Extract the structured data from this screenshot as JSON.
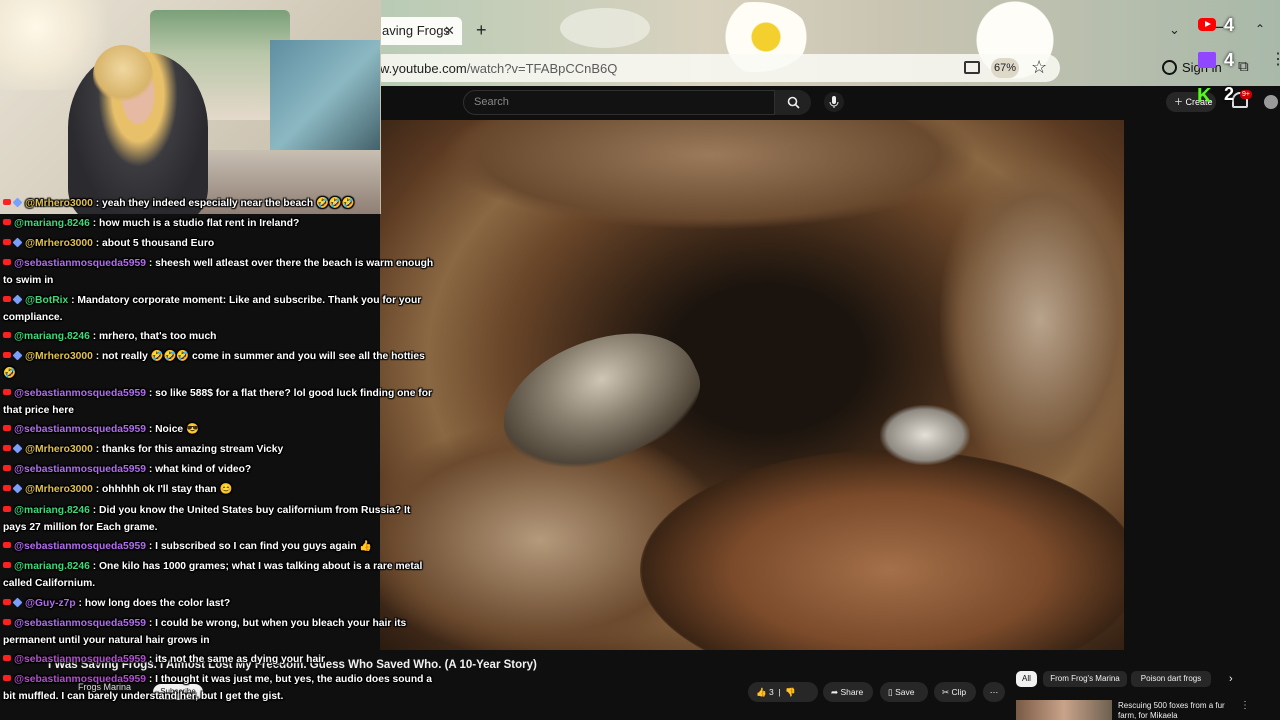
{
  "browser": {
    "tab_title": "aving Frogs",
    "tab_close": "✕",
    "new_tab": "+",
    "tab_menu": "⌄",
    "url_host": "w.youtube.com",
    "url_path": "/watch?v=TFABpCCnB6Q",
    "zoom": "67%",
    "sign_in": "Sign in"
  },
  "youtube": {
    "search_placeholder": "Search",
    "create_label": "Create",
    "notification_count": "9+",
    "video_title": "I Was Saving Frogs. I Almost Lost My Freedom. Guess Who Saved Who. (A 10-Year Story)",
    "channel_name": "Frogs Marina",
    "subscribe_label": "Subscribe",
    "like_count": "3",
    "share_label": "Share",
    "save_label": "Save",
    "clip_label": "Clip",
    "chips": [
      "All",
      "From Frog's Marina",
      "Poison dart frogs"
    ],
    "recommended_title": "Rescuing 500 foxes from a fur farm, for Mikaela"
  },
  "stream_overlay": {
    "youtube_viewers": "4",
    "twitch_viewers": "4",
    "kick_viewers": "2"
  },
  "chat": [
    {
      "user": "@Mrhero3000",
      "platform": "youtube",
      "mod": true,
      "color": "gold",
      "text": "yeah they indeed especially near the beach 🤣🤣🤣"
    },
    {
      "user": "@mariang.8246",
      "platform": "youtube",
      "mod": false,
      "color": "green",
      "text": "how much is a studio flat rent in Ireland?"
    },
    {
      "user": "@Mrhero3000",
      "platform": "youtube",
      "mod": true,
      "color": "gold",
      "text": "about 5 thousand Euro"
    },
    {
      "user": "@sebastianmosqueda5959",
      "platform": "youtube",
      "mod": false,
      "color": "purple",
      "text": "sheesh well atleast over there the beach is warm enough to swim in"
    },
    {
      "user": "@BotRix",
      "platform": "youtube",
      "mod": true,
      "color": "green",
      "text": "Mandatory corporate moment: Like and subscribe. Thank you for your compliance."
    },
    {
      "user": "@mariang.8246",
      "platform": "youtube",
      "mod": false,
      "color": "green",
      "text": "mrhero, that's too much"
    },
    {
      "user": "@Mrhero3000",
      "platform": "youtube",
      "mod": true,
      "color": "gold",
      "text": "not really 🤣🤣🤣 come in summer and you will see all the hotties 🤣"
    },
    {
      "user": "@sebastianmosqueda5959",
      "platform": "youtube",
      "mod": false,
      "color": "purple",
      "text": "so like 588$ for a flat there? lol good luck finding one for that price here"
    },
    {
      "user": "@sebastianmosqueda5959",
      "platform": "youtube",
      "mod": false,
      "color": "purple",
      "text": "Noice 😎"
    },
    {
      "user": "@Mrhero3000",
      "platform": "youtube",
      "mod": true,
      "color": "gold",
      "text": "thanks for this amazing stream Vicky"
    },
    {
      "user": "@sebastianmosqueda5959",
      "platform": "youtube",
      "mod": false,
      "color": "purple",
      "text": "what kind of video?"
    },
    {
      "user": "@Mrhero3000",
      "platform": "youtube",
      "mod": true,
      "color": "gold",
      "text": "ohhhhh ok I'll stay than 😊"
    },
    {
      "user": "@mariang.8246",
      "platform": "youtube",
      "mod": false,
      "color": "green",
      "text": "Did you know the United States buy californium from Russia? It pays 27 million for Each grame."
    },
    {
      "user": "@sebastianmosqueda5959",
      "platform": "youtube",
      "mod": false,
      "color": "purple",
      "text": "I subscribed so I can find you guys again 👍"
    },
    {
      "user": "@mariang.8246",
      "platform": "youtube",
      "mod": false,
      "color": "green",
      "text": "One kilo has 1000 grames; what I was talking about is a rare metal called Californium."
    },
    {
      "user": "@Guy-z7p",
      "platform": "youtube",
      "mod": true,
      "color": "purple",
      "text": "how long does the color last?"
    },
    {
      "user": "@sebastianmosqueda5959",
      "platform": "youtube",
      "mod": false,
      "color": "purple",
      "text": "I could be wrong, but when you bleach your hair its permanent until your natural hair grows in"
    },
    {
      "user": "@sebastianmosqueda5959",
      "platform": "youtube",
      "mod": false,
      "color": "yt",
      "text": "its not the same as dying your hair"
    },
    {
      "user": "@sebastianmosqueda5959",
      "platform": "youtube",
      "mod": false,
      "color": "yt",
      "text": "I thought it was just me, but yes, the audio does sound a bit muffled. I can barely understand her, but I get the gist."
    }
  ]
}
